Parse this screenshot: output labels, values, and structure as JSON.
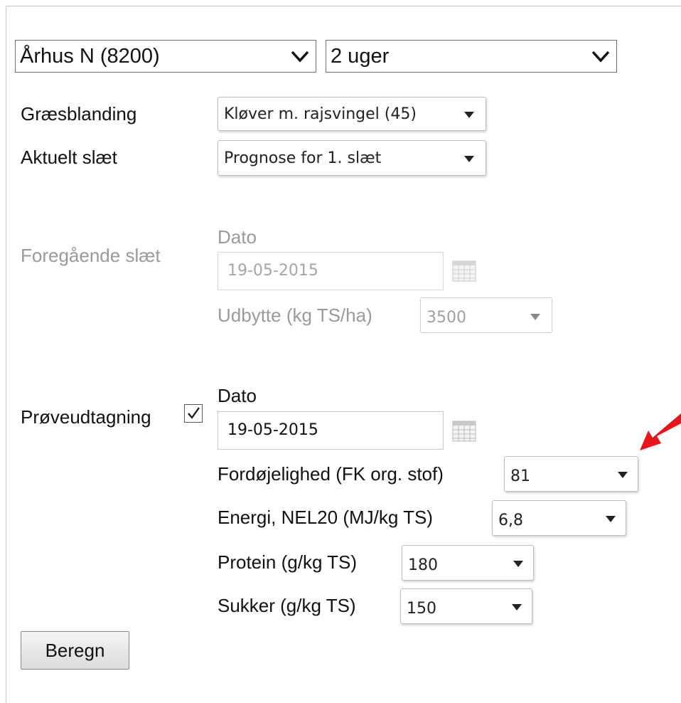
{
  "location_select": {
    "value": "Århus N (8200)"
  },
  "period_select": {
    "value": "2 uger"
  },
  "grass_mix": {
    "label": "Græsblanding",
    "value": "Kløver m. rajsvingel (45)"
  },
  "current_cut": {
    "label": "Aktuelt slæt",
    "value": "Prognose for 1. slæt"
  },
  "previous_cut": {
    "label": "Foregående slæt",
    "date_label": "Dato",
    "date_value": "19-05-2015",
    "yield_label": "Udbytte (kg TS/ha)",
    "yield_value": "3500"
  },
  "sampling": {
    "label": "Prøveudtagning",
    "checked": true,
    "date_label": "Dato",
    "date_value": "19-05-2015",
    "digestibility_label": "Fordøjelighed (FK org. stof)",
    "digestibility_value": "81",
    "energy_label": "Energi, NEL20 (MJ/kg TS)",
    "energy_value": "6,8",
    "protein_label": "Protein (g/kg TS)",
    "protein_value": "180",
    "sugar_label": "Sukker (g/kg TS)",
    "sugar_value": "150"
  },
  "calculate_button": {
    "label": "Beregn"
  },
  "colors": {
    "annotation_arrow": "#e8141b",
    "disabled_text": "#9a9a9a"
  },
  "icons": [
    "chevron-down-icon",
    "caret-down-icon",
    "calendar-icon",
    "checkmark-icon",
    "red-arrow-icon"
  ]
}
